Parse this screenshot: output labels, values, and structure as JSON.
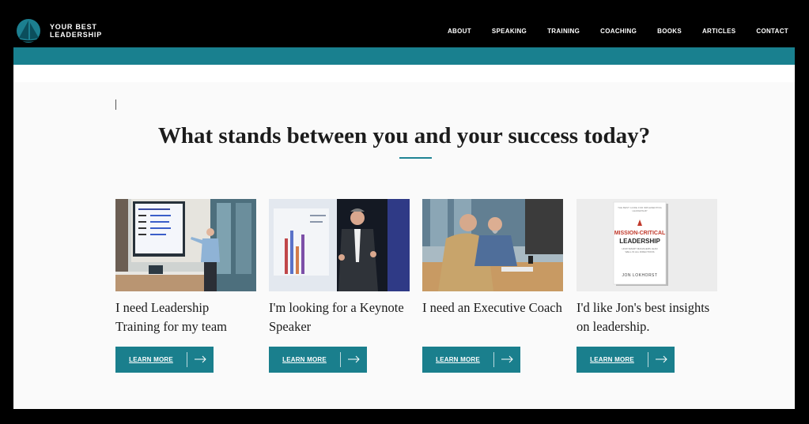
{
  "brand": {
    "line1": "YOUR BEST",
    "line2": "LEADERSHIP"
  },
  "nav": [
    "ABOUT",
    "SPEAKING",
    "TRAINING",
    "COACHING",
    "BOOKS",
    "ARTICLES",
    "CONTACT"
  ],
  "headline": "What stands between you and your success today?",
  "cards": [
    {
      "title": "I need Leadership Training for my team",
      "button": "LEARN MORE",
      "image": "training-photo"
    },
    {
      "title": "I'm looking for a Keynote Speaker",
      "button": "LEARN MORE",
      "image": "speaker-photo"
    },
    {
      "title": "I need an Executive Coach",
      "button": "LEARN MORE",
      "image": "coaching-photo"
    },
    {
      "title": "I'd like Jon's best insights on leadership.",
      "button": "LEARN MORE",
      "image": "book-cover"
    }
  ],
  "book": {
    "top_line": "THE BEST GUIDE FOR IMPLEMENTING LEADERSHIP",
    "title1": "MISSION-CRITICAL",
    "title2": "LEADERSHIP",
    "subtitle": "HOW SMART MANAGERS LEAD WELL IN ALL DIRECTIONS",
    "author": "JON LOKHORST"
  },
  "colors": {
    "teal": "#19808f",
    "button": "#1a7f8d",
    "header": "#000000"
  }
}
